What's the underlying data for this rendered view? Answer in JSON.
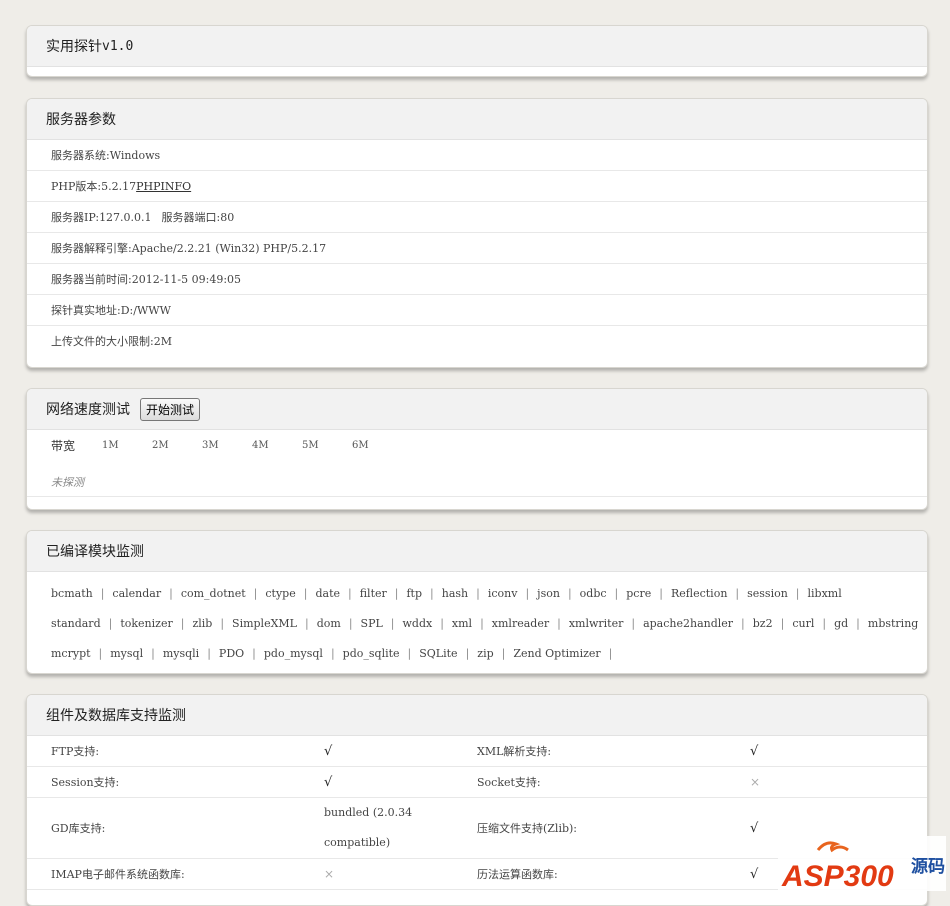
{
  "header": {
    "title": "实用探针",
    "version": "v1.0"
  },
  "server": {
    "title": "服务器参数",
    "rows": [
      {
        "label": "服务器系统:",
        "value": "Windows"
      },
      {
        "label": "PHP版本:",
        "value": "5.2.17",
        "link": "PHPINFO"
      },
      {
        "label": "服务器IP:",
        "value": "127.0.0.1",
        "label2": "服务器端口:",
        "value2": "80"
      },
      {
        "label": "服务器解释引擎:",
        "value": "Apache/2.2.21 (Win32) PHP/5.2.17"
      },
      {
        "label": "服务器当前时间:",
        "value": "2012-11-5 09:49:05"
      },
      {
        "label": "探针真实地址:",
        "value": "D:/WWW"
      },
      {
        "label": "上传文件的大小限制:",
        "value": " 2M"
      }
    ]
  },
  "speed": {
    "title": "网络速度测试",
    "button": "开始测试",
    "bandwidth_label": "带宽",
    "marks": [
      "1M",
      "2M",
      "3M",
      "4M",
      "5M",
      "6M"
    ],
    "status": "未探测"
  },
  "modules": {
    "title": "已编译模块监测",
    "lines": [
      [
        "bcmath",
        "calendar",
        "com_dotnet",
        "ctype",
        "date",
        "filter",
        "ftp",
        "hash",
        "iconv",
        "json",
        "odbc",
        "pcre",
        "Reflection",
        "session",
        "libxml"
      ],
      [
        "standard",
        "tokenizer",
        "zlib",
        "SimpleXML",
        "dom",
        "SPL",
        "wddx",
        "xml",
        "xmlreader",
        "xmlwriter",
        "apache2handler",
        "bz2",
        "curl",
        "gd",
        "mbstring"
      ],
      [
        "mcrypt",
        "mysql",
        "mysqli",
        "PDO",
        "pdo_mysql",
        "pdo_sqlite",
        "SQLite",
        "zip",
        "Zend Optimizer"
      ]
    ]
  },
  "components": {
    "title": "组件及数据库支持监测",
    "rows": [
      {
        "l1": "FTP支持:",
        "v1": "√",
        "l2": "XML解析支持:",
        "v2": "√"
      },
      {
        "l1": "Session支持:",
        "v1": "√",
        "l2": "Socket支持:",
        "v2": "×"
      },
      {
        "l1": "GD库支持:",
        "v1": "bundled (2.0.34 compatible)",
        "l2": "压缩文件支持(Zlib):",
        "v2": "√"
      },
      {
        "l1": "IMAP电子邮件系统函数库:",
        "v1": "×",
        "l2": "历法运算函数库:",
        "v2": "√"
      }
    ]
  },
  "watermark": {
    "brand": "ASP300",
    "suffix": "源码"
  }
}
